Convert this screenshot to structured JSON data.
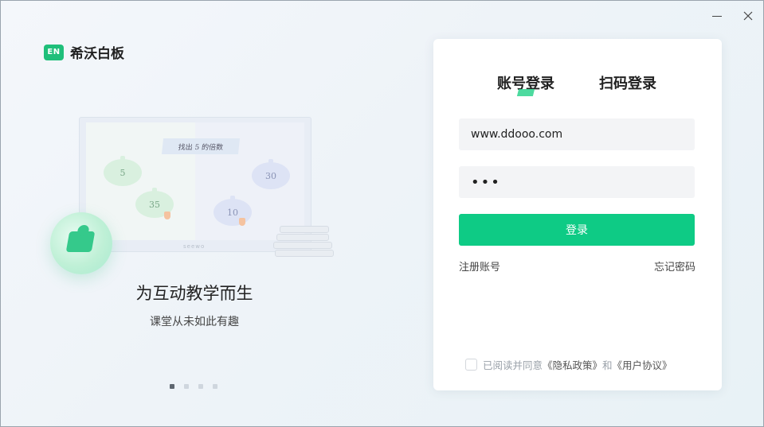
{
  "window": {
    "minimize_icon": "minimize-icon",
    "close_icon": "close-icon"
  },
  "brand": {
    "badge": "EN",
    "name": "希沃白板",
    "accent": "#1fbf7a"
  },
  "illustration": {
    "board_title": "找出 5 的倍数",
    "apples": [
      "5",
      "30",
      "35",
      "10"
    ],
    "brand_mark": "seewo"
  },
  "promo": {
    "title": "为互动教学而生",
    "subtitle": "课堂从未如此有趣",
    "carousel_count": 4,
    "carousel_active": 1
  },
  "login": {
    "tabs": [
      "账号登录",
      "扫码登录"
    ],
    "active_tab": "账号登录",
    "username_value": "www.ddooo.com",
    "password_value": "•••",
    "submit_label": "登录",
    "register_label": "注册账号",
    "forgot_label": "忘记密码",
    "agreement_prefix": "已阅读并同意",
    "privacy_link": "《隐私政策》",
    "agreement_and": "和",
    "terms_link": "《用户协议》",
    "button_color": "#0ecb85"
  }
}
